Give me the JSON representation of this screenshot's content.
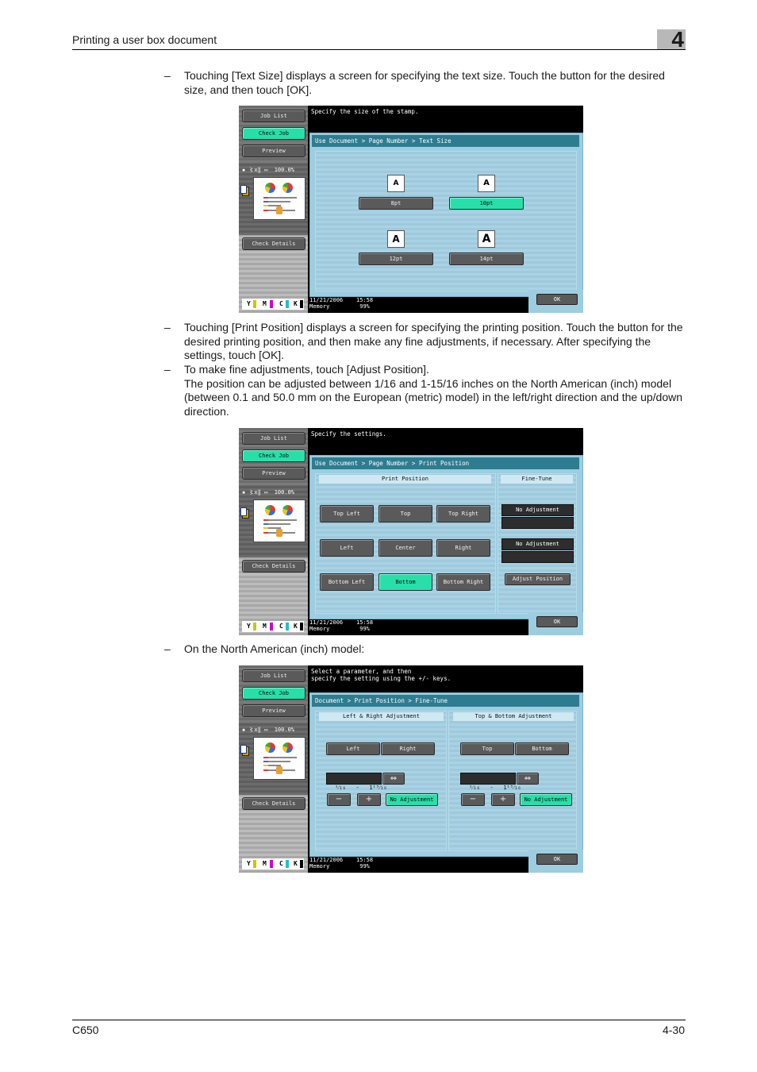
{
  "header": {
    "title": "Printing a user box document",
    "chapter": "4"
  },
  "paragraphs": [
    {
      "dash": "–",
      "text": "Touching [Text Size] displays a screen for specifying the text size. Touch the button for the desired size, and then touch [OK]."
    },
    {
      "dash": "–",
      "text": "Touching [Print Position] displays a screen for specifying the printing position. Touch the button for the desired printing position, and then make any fine adjustments, if necessary. After specifying the settings, touch [OK]."
    },
    {
      "dash": "–",
      "text": "To make fine adjustments, touch [Adjust Position].",
      "text2": "The position can be adjusted between 1/16 and 1-15/16 inches on the North American (inch) model (between 0.1 and 50.0 mm on the European (metric) model) in the left/right direction and the up/down direction."
    },
    {
      "dash": "–",
      "text": "On the North American (inch) model:"
    }
  ],
  "sidebar": {
    "job_list": "Job List",
    "check_job": "Check Job",
    "preview": "Preview",
    "zoom_line": "▪ 〻x‖ ▭  100.0%",
    "check_details": "Check Details",
    "toner": [
      "Y",
      "M",
      "C",
      "K"
    ]
  },
  "toner_colors": {
    "Y": "#c8c800",
    "M": "#d000d0",
    "C": "#20c0d0",
    "K": "#000000"
  },
  "status": {
    "date": "11/21/2006",
    "time": "15:58",
    "memory_label": "Memory",
    "memory_value": "99%"
  },
  "ok_label": "OK",
  "screen1": {
    "message": "Specify the size of the stamp.",
    "breadcrumb": "Use Document > Page Number > Text Size",
    "sample": "A",
    "sizes": [
      {
        "label": "8pt",
        "selected": false
      },
      {
        "label": "10pt",
        "selected": true
      },
      {
        "label": "12pt",
        "selected": false
      },
      {
        "label": "14pt",
        "selected": false
      }
    ]
  },
  "screen2": {
    "message": "Specify the settings.",
    "breadcrumb": "Use Document > Page Number > Print Position",
    "print_position_heading": "Print Position",
    "fine_tune_heading": "Fine-Tune",
    "positions": [
      {
        "label": "Top Left",
        "selected": false
      },
      {
        "label": "Top",
        "selected": false
      },
      {
        "label": "Top Right",
        "selected": false
      },
      {
        "label": "Left",
        "selected": false
      },
      {
        "label": "Center",
        "selected": false
      },
      {
        "label": "Right",
        "selected": false
      },
      {
        "label": "Bottom Left",
        "selected": false
      },
      {
        "label": "Bottom",
        "selected": true
      },
      {
        "label": "Bottom Right",
        "selected": false
      }
    ],
    "fine_tune_1": "No Adjustment",
    "fine_tune_2": "No Adjustment",
    "adjust_position": "Adjust Position"
  },
  "screen3": {
    "message": "Select a parameter, and then\nspecify the setting using the +/- keys.",
    "breadcrumb": "Document > Print Position > Fine-Tune",
    "lr_heading": "Left & Right Adjustment",
    "tb_heading": "Top & Bottom Adjustment",
    "lr_left": "Left",
    "lr_right": "Right",
    "tb_top": "Top",
    "tb_bottom": "Bottom",
    "swap_icon": "⇔",
    "range": "¹⁄₁₆   -   1¹⁵⁄₁₆",
    "minus": "−",
    "plus": "+",
    "no_adjustment": "No Adjustment"
  },
  "footer": {
    "model": "C650",
    "page": "4-30"
  }
}
